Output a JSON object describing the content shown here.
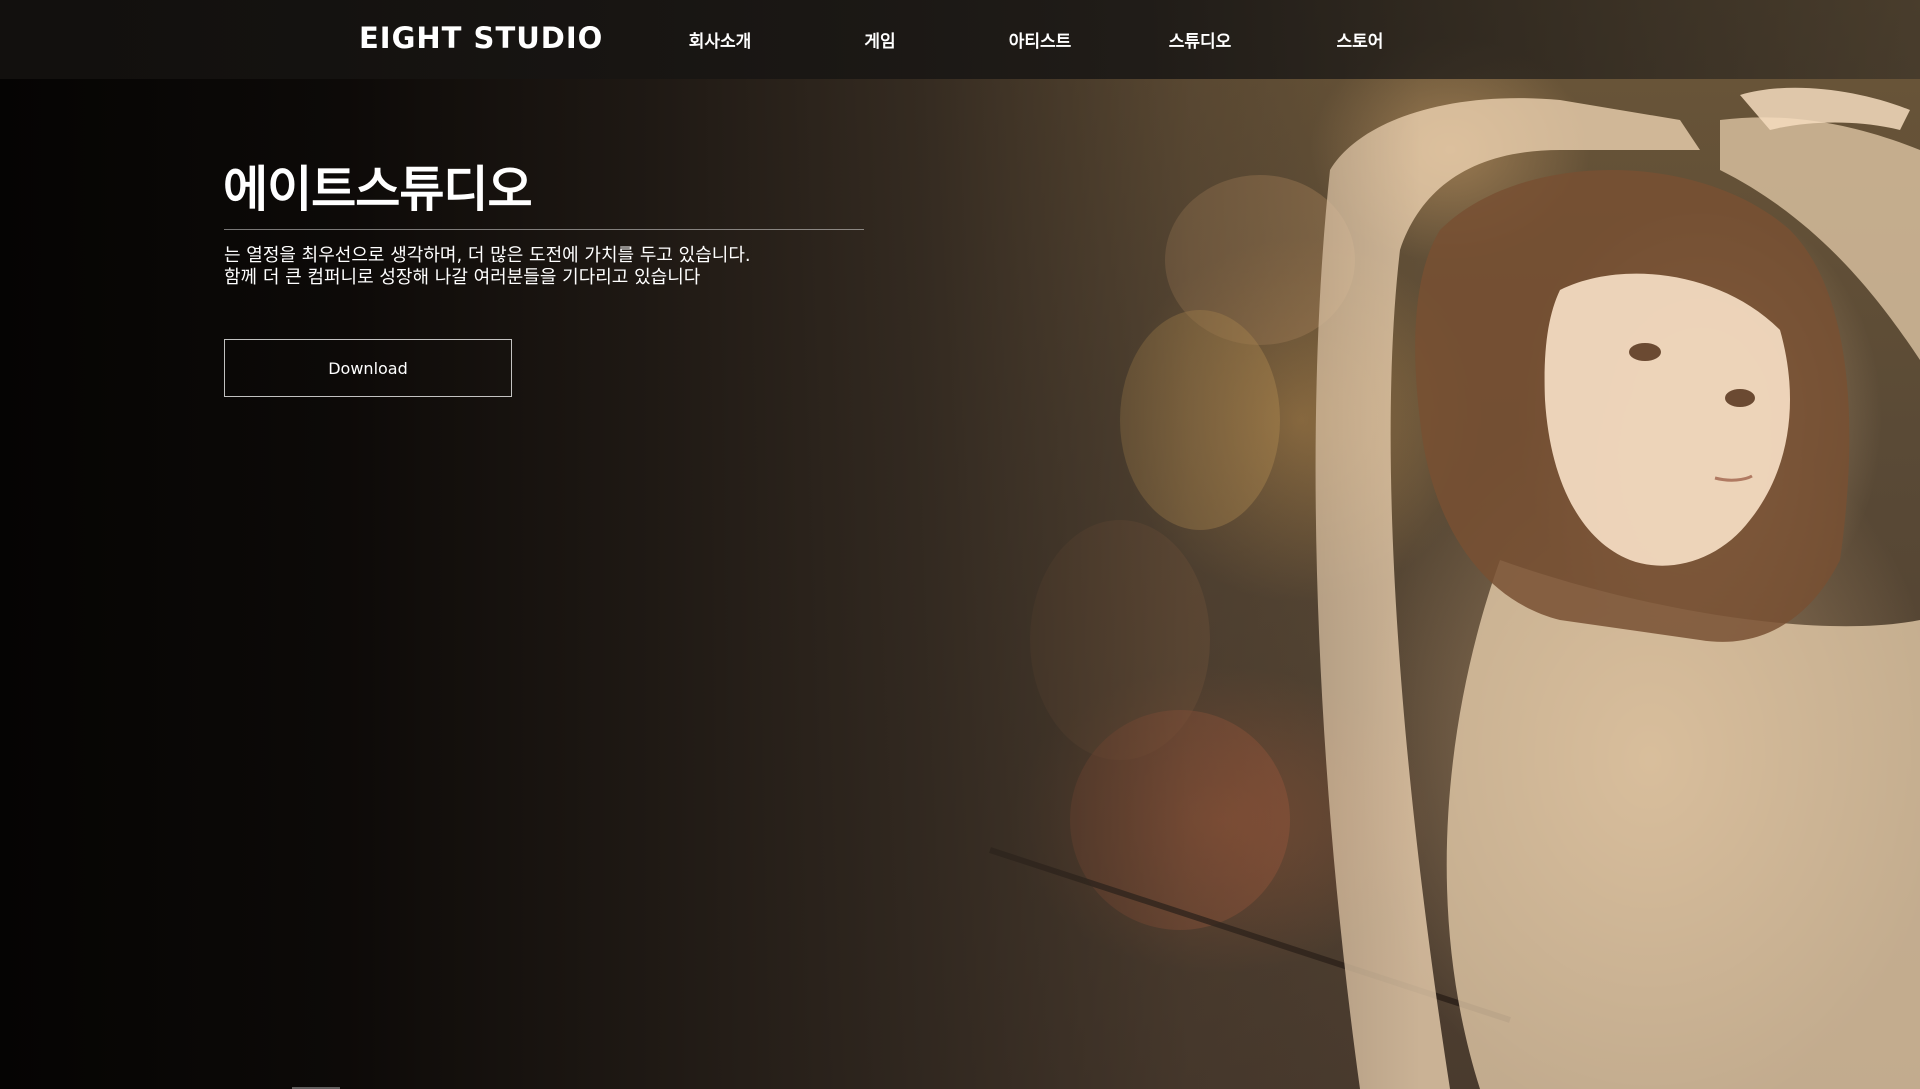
{
  "header": {
    "logo_text": "EIGHT STUDIO",
    "nav": [
      {
        "label": "회사소개"
      },
      {
        "label": "게임"
      },
      {
        "label": "아티스트"
      },
      {
        "label": "스튜디오"
      },
      {
        "label": "스토어"
      }
    ]
  },
  "hero": {
    "title": "에이트스튜디오",
    "description_line1": "는 열정을 최우선으로 생각하며, 더 많은 도전에 가치를 두고 있습니다.",
    "description_line2": "함께 더 큰 컴퍼니로 성장해 나갈 여러분들을 기다리고 있습니다",
    "download_label": "Download"
  },
  "colors": {
    "text": "#ffffff",
    "background_dark": "#0a0807",
    "accent_warm": "#d9b98c"
  }
}
